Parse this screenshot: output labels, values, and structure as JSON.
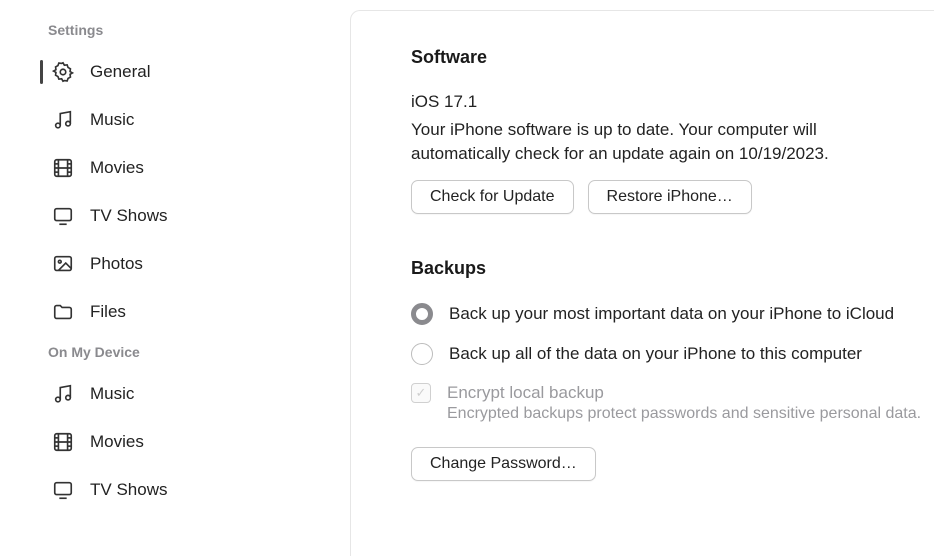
{
  "sidebar": {
    "section_settings": "Settings",
    "section_device": "On My Device",
    "items": [
      {
        "label": "General"
      },
      {
        "label": "Music"
      },
      {
        "label": "Movies"
      },
      {
        "label": "TV Shows"
      },
      {
        "label": "Photos"
      },
      {
        "label": "Files"
      }
    ],
    "device_items": [
      {
        "label": "Music"
      },
      {
        "label": "Movies"
      },
      {
        "label": "TV Shows"
      }
    ]
  },
  "software": {
    "heading": "Software",
    "version": "iOS 17.1",
    "description": "Your iPhone software is up to date. Your computer will automatically check for an update again on 10/19/2023.",
    "check_update_label": "Check for Update",
    "restore_label": "Restore iPhone…"
  },
  "backups": {
    "heading": "Backups",
    "option_icloud": "Back up your most important data on your iPhone to iCloud",
    "option_computer": "Back up all of the data on your iPhone to this computer",
    "encrypt_label": "Encrypt local backup",
    "encrypt_sub": "Encrypted backups protect passwords and sensitive personal data.",
    "change_password_label": "Change Password…"
  }
}
